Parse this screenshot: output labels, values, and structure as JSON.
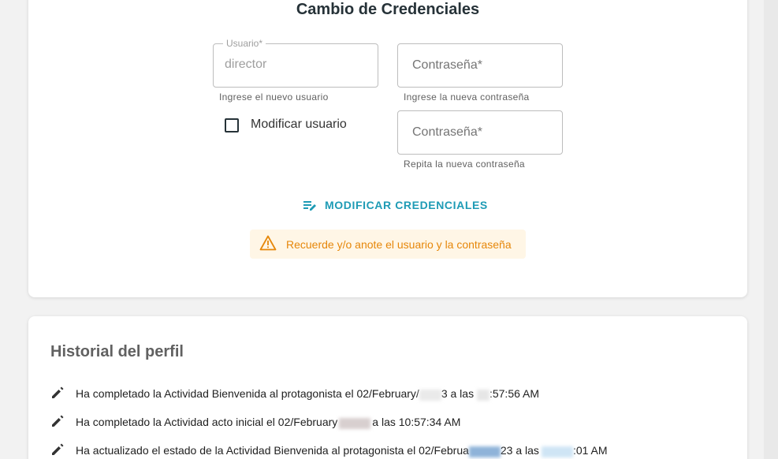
{
  "credentials": {
    "title": "Cambio de Credenciales",
    "username_field": {
      "label": "Usuario*",
      "value": "director",
      "hint": "Ingrese el nuevo usuario"
    },
    "password_field": {
      "placeholder": "Contraseña*",
      "hint": "Ingrese la nueva contraseña"
    },
    "password_repeat_field": {
      "placeholder": "Contraseña*",
      "hint": "Repita la nueva contraseña"
    },
    "modify_user_checkbox": {
      "label": "Modificar usuario",
      "checked": false
    },
    "submit_button": {
      "label": "MODIFICAR CREDENCIALES",
      "icon": "edit-note-icon"
    },
    "warning": {
      "icon": "warning-icon",
      "text": "Recuerde y/o anote el usuario y la contraseña"
    }
  },
  "history": {
    "title": "Historial del perfil",
    "items": [
      {
        "icon": "pencil-icon",
        "text_start": "Ha completado la Actividad Bienvenida al protagonista el 02/February/",
        "text_mid": "3 a las ",
        "text_end": ":57:56 AM"
      },
      {
        "icon": "pencil-icon",
        "text_start": "Ha completado la Actividad acto inicial el 02/February",
        "text_mid": "a las 10:57:34 AM",
        "text_end": ""
      },
      {
        "icon": "pencil-icon",
        "text_start": "Ha actualizado el estado de la Actividad Bienvenida al protagonista el 02/Februa",
        "text_mid": "23 a las",
        "text_end": ":01 AM"
      }
    ]
  },
  "colors": {
    "accent": "#1e9bb5",
    "warning": "#e6870a",
    "warning_bg": "#fff6e6",
    "page_bg": "#f2f2f2"
  }
}
